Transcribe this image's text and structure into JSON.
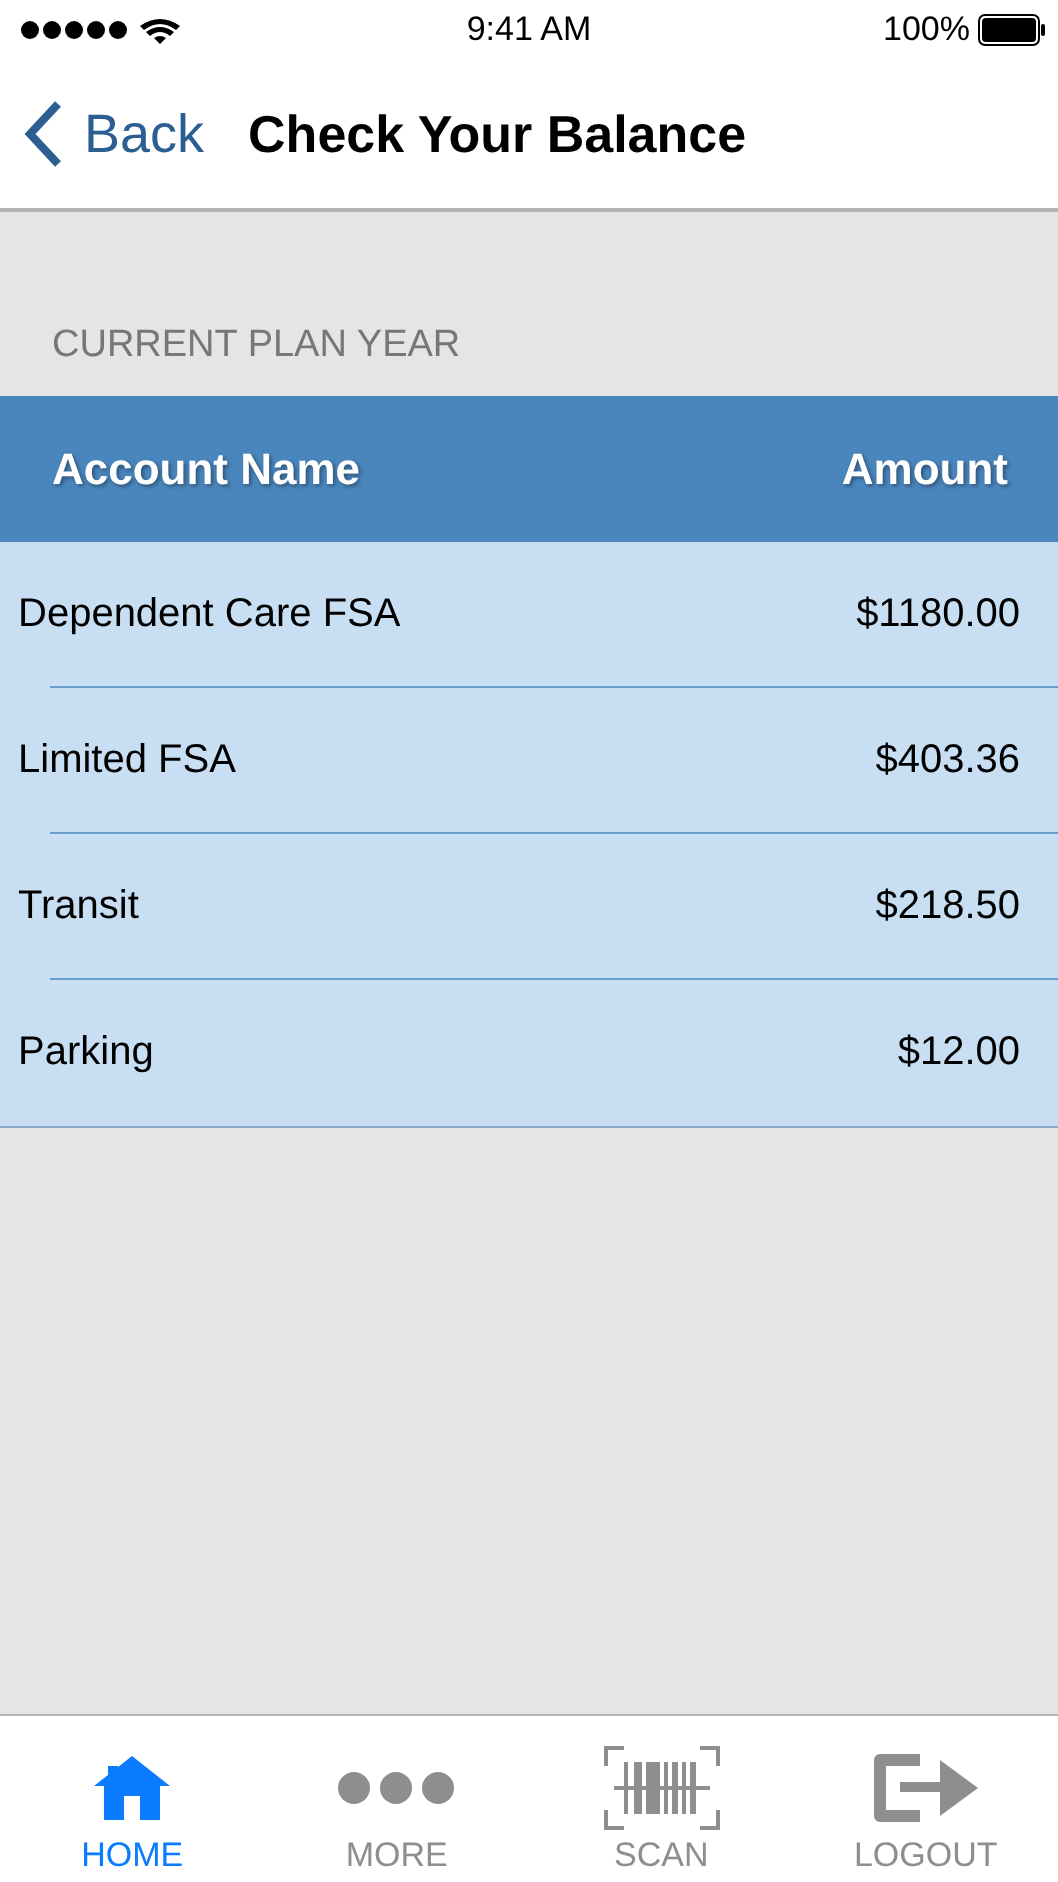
{
  "status_bar": {
    "time": "9:41 AM",
    "battery": "100%"
  },
  "nav": {
    "back": "Back",
    "title": "Check Your Balance"
  },
  "section": "CURRENT PLAN YEAR",
  "table": {
    "columns": [
      "Account Name",
      "Amount"
    ],
    "rows": [
      [
        "Dependent Care FSA",
        "$1180.00"
      ],
      [
        "Limited FSA",
        "$403.36"
      ],
      [
        "Transit",
        "$218.50"
      ],
      [
        "Parking",
        "$12.00"
      ]
    ]
  },
  "tab_bar": [
    {
      "kind": "home",
      "label": "HOME",
      "selected": true
    },
    {
      "kind": "more",
      "label": "MORE",
      "selected": false
    },
    {
      "kind": "scan",
      "label": "SCAN",
      "selected": false
    },
    {
      "kind": "logout",
      "label": "LOGOUT",
      "selected": false
    }
  ]
}
